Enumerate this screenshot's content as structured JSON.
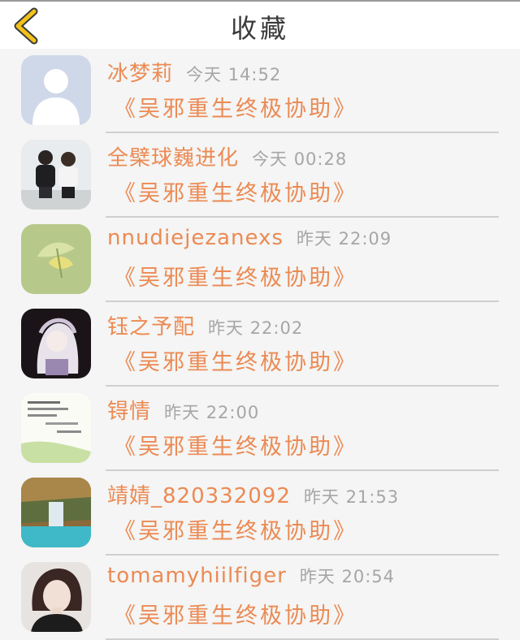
{
  "header": {
    "title": "收藏",
    "back_icon": "chevron-left-icon",
    "accent_color": "#f2c21a"
  },
  "items": [
    {
      "name": "冰梦莉",
      "time": "今天 14:52",
      "title": "《吴邪重生终极协助》",
      "avatar": "default-avatar"
    },
    {
      "name": "全檗球巍进化",
      "time": "今天 00:28",
      "title": "《吴邪重生终极协助》",
      "avatar": "couple-photo"
    },
    {
      "name": "nnudiejezanexs",
      "time": "昨天 22:09",
      "title": "《吴邪重生终极协助》",
      "avatar": "green-leaf"
    },
    {
      "name": "钰之予配",
      "time": "昨天 22:02",
      "title": "《吴邪重生终极协助》",
      "avatar": "anime-girl"
    },
    {
      "name": "锝情",
      "time": "昨天 22:00",
      "title": "《吴邪重生终极协助》",
      "avatar": "text-note"
    },
    {
      "name": "靖婧_820332092",
      "time": "昨天 21:53",
      "title": "《吴邪重生终极协助》",
      "avatar": "waterfall"
    },
    {
      "name": "tomamyhiilfiger",
      "time": "昨天 20:54",
      "title": "《吴邪重生终极协助》",
      "avatar": "woman-portrait"
    }
  ],
  "colors": {
    "name_text": "#ec8a54",
    "time_text": "#a6a6a6",
    "background": "#f4f5f4"
  }
}
